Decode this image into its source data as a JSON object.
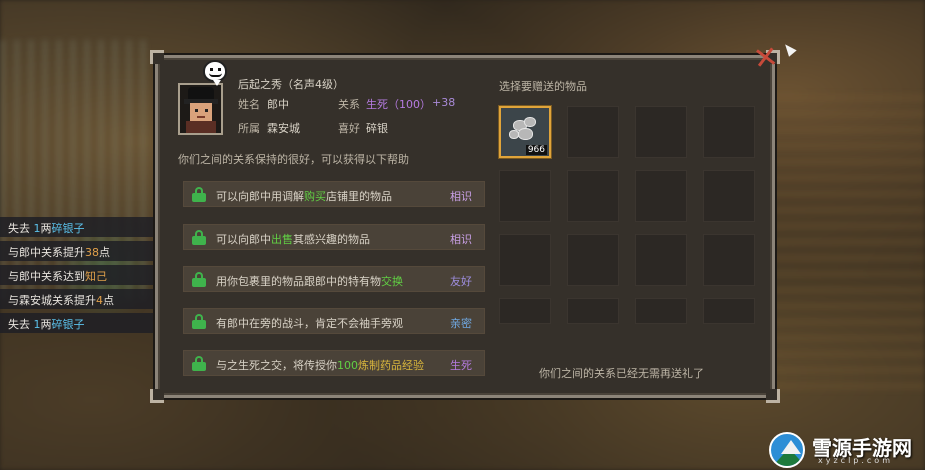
{
  "npc": {
    "title": "后起之秀（名声4级）",
    "name_label": "姓名",
    "name": "郎中",
    "relation_label": "关系",
    "relation_value": "生死（100）",
    "relation_bonus": "+38",
    "belong_label": "所属",
    "belong": "霖安城",
    "likes_label": "喜好",
    "likes": "碎银",
    "intro": "你们之间的关系保持的很好，可以获得以下帮助"
  },
  "help": [
    {
      "pre": "可以向郎中用调解",
      "hl": "购买",
      "post": "店铺里的物品",
      "level": "相识",
      "level_color": "#c9a0e6"
    },
    {
      "pre": "可以向郎中",
      "hl": "出售",
      "post": "其感兴趣的物品",
      "level": "相识",
      "level_color": "#c9a0e6"
    },
    {
      "pre": "用你包裹里的物品跟郎中的特有物",
      "hl": "交换",
      "post": "",
      "level": "友好",
      "level_color": "#9f8ee0"
    },
    {
      "pre": "有郎中在旁的战斗，肯定不会袖手旁观",
      "hl": "",
      "post": "",
      "level": "亲密",
      "level_color": "#70a9e3"
    },
    {
      "pre": "与之生死之交，将传授你",
      "hl": "100",
      "hl2": "炼制药品经验",
      "post": "",
      "level": "生死",
      "level_color": "#b57be0"
    }
  ],
  "gift": {
    "heading": "选择要赠送的物品",
    "selected_item": "silver-ore-icon",
    "selected_count": "966",
    "notice": "你们之间的关系已经无需再送礼了"
  },
  "log": [
    {
      "pre": "失去 ",
      "b": "1",
      "mid": "两",
      "o": "",
      "post": "碎银子"
    },
    {
      "pre": "与郎中关系提升",
      "b": "",
      "mid": "",
      "o": "38",
      "post": "点"
    },
    {
      "pre": "与郎中关系达到",
      "b": "",
      "mid": "",
      "o": "知己",
      "post": ""
    },
    {
      "pre": "与霖安城关系提升",
      "b": "",
      "mid": "",
      "o": "4",
      "post": "点"
    },
    {
      "pre": "失去 ",
      "b": "1",
      "mid": "两",
      "o": "",
      "post": "碎银子"
    }
  ],
  "watermark": {
    "title": "雪源手游网",
    "url": "xyzclp.com"
  },
  "colors": {
    "accent_green": "#61cf44",
    "lock_green": "#3fb34c",
    "purple": "#b57be0",
    "gold_border": "#e0a43a"
  }
}
